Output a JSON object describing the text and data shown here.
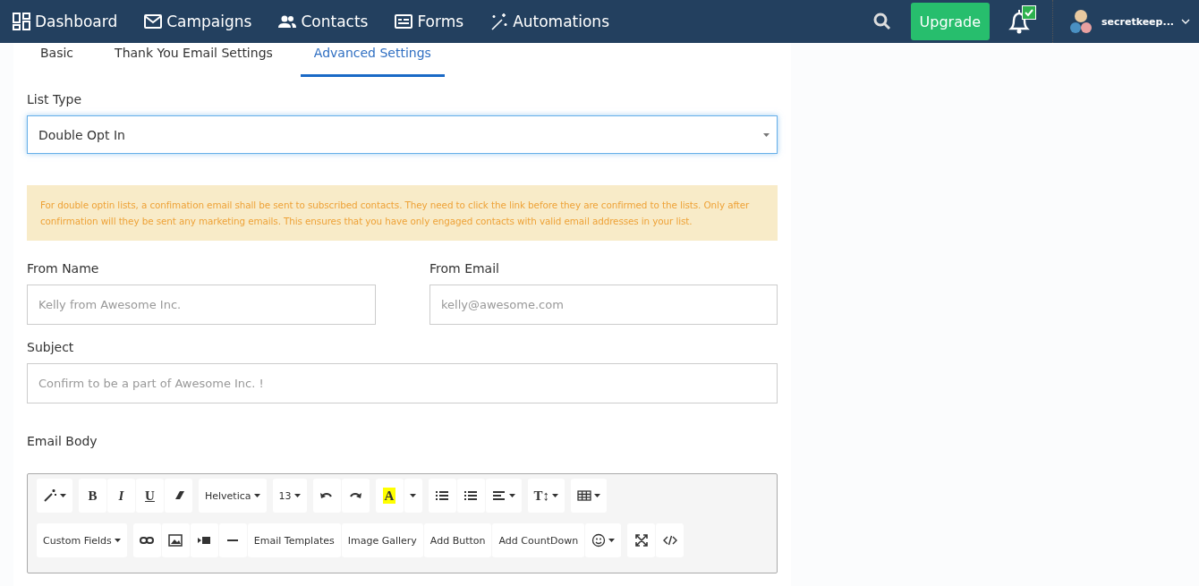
{
  "nav": {
    "items": [
      {
        "kind": "dashboard",
        "label": "Dashboard"
      },
      {
        "kind": "campaigns",
        "label": "Campaigns"
      },
      {
        "kind": "contacts",
        "label": "Contacts"
      },
      {
        "kind": "forms",
        "label": "Forms"
      },
      {
        "kind": "automations",
        "label": "Automations"
      }
    ],
    "upgrade": "Upgrade",
    "user": "secretkeep...",
    "notification_badge": true
  },
  "tabs": [
    {
      "label": "Basic",
      "selected": false
    },
    {
      "label": "Thank You Email Settings",
      "selected": false
    },
    {
      "label": "Advanced Settings",
      "selected": true
    }
  ],
  "list_type": {
    "label": "List Type",
    "value": "Double Opt In"
  },
  "notice": "For double optin lists, a confimation email shall be sent to subscribed contacts. They need to click the link before they are confirmed to the lists. Only after confirmation will they be sent any marketing emails. This ensures that you have only engaged contacts with valid email addresses in your list.",
  "from_name": {
    "label": "From Name",
    "placeholder": "Kelly from Awesome Inc."
  },
  "from_email": {
    "label": "From Email",
    "placeholder": "kelly@awesome.com"
  },
  "subject": {
    "label": "Subject",
    "placeholder": "Confirm to be a part of Awesome Inc. !"
  },
  "email_body": {
    "label": "Email Body",
    "toolbar_rows": [
      [
        [
          {
            "kind": "magic",
            "caret": true
          }
        ],
        [
          {
            "kind": "bold",
            "text": "B"
          },
          {
            "kind": "italic",
            "text": "I"
          },
          {
            "kind": "underline",
            "text": "U"
          },
          {
            "kind": "eraser"
          }
        ],
        [
          {
            "kind": "text",
            "text": "Helvetica",
            "caret": true
          }
        ],
        [
          {
            "kind": "text",
            "text": "13",
            "caret": true
          }
        ],
        [
          {
            "kind": "undo"
          },
          {
            "kind": "redo"
          }
        ],
        [
          {
            "kind": "highlight",
            "text": "A"
          },
          {
            "kind": "caretonly"
          }
        ],
        [
          {
            "kind": "bullets"
          },
          {
            "kind": "numbers"
          },
          {
            "kind": "align",
            "caret": true
          }
        ],
        [
          {
            "kind": "textsize",
            "text": "T↕",
            "caret": true
          }
        ],
        [
          {
            "kind": "table",
            "caret": true
          }
        ]
      ],
      [
        [
          {
            "kind": "text",
            "text": "Custom Fields",
            "caret": true
          }
        ],
        [
          {
            "kind": "link"
          },
          {
            "kind": "image"
          },
          {
            "kind": "video"
          },
          {
            "kind": "rule"
          },
          {
            "kind": "text",
            "text": "Email Templates"
          },
          {
            "kind": "text",
            "text": "Image Gallery"
          },
          {
            "kind": "text",
            "text": "Add Button"
          },
          {
            "kind": "text",
            "text": "Add CountDown"
          },
          {
            "kind": "emoji",
            "caret": true
          }
        ],
        [
          {
            "kind": "expand"
          },
          {
            "kind": "code"
          }
        ]
      ]
    ]
  }
}
